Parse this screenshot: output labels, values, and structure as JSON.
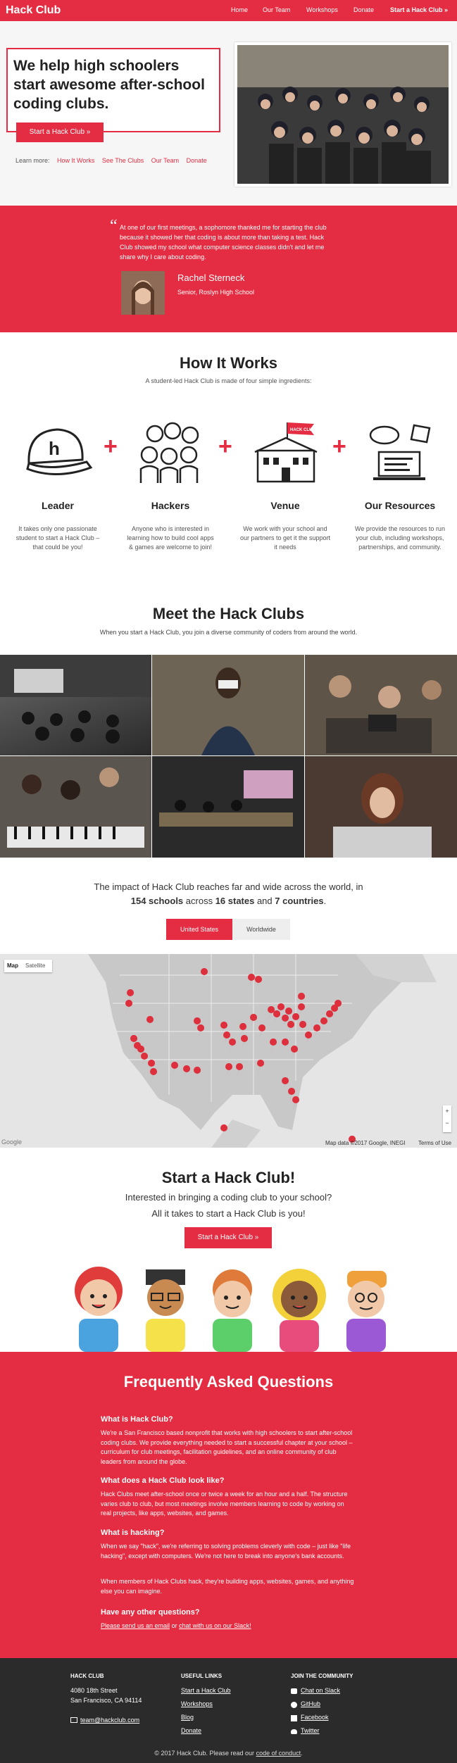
{
  "nav": {
    "logo": "Hack Club",
    "links": [
      "Home",
      "Our Team",
      "Workshops",
      "Donate"
    ],
    "cta": "Start a Hack Club »"
  },
  "hero": {
    "title": "We help high schoolers start awesome after-school coding clubs.",
    "button": "Start a Hack Club »",
    "learn_more_label": "Learn more:",
    "learn_links": [
      "How It Works",
      "See The Clubs",
      "Our Team",
      "Donate"
    ]
  },
  "testimonial": {
    "quote": "At one of our first meetings, a sophomore thanked me for starting the club because it showed her that coding is about more than taking a test. Hack Club showed my school what computer science classes didn't and let me share why I care about coding.",
    "name": "Rachel Sterneck",
    "role": "Senior, Roslyn High School"
  },
  "how": {
    "title": "How It Works",
    "subtitle": "A student-led Hack Club is made of four simple ingredients:",
    "banner_text": "HACK CLUB",
    "items": [
      {
        "title": "Leader",
        "desc": "It takes only one passionate student to start a Hack Club – that could be you!",
        "icon": "cap-icon"
      },
      {
        "title": "Hackers",
        "desc": "Anyone who is interested in learning how to build cool apps & games are welcome to join!",
        "icon": "people-icon"
      },
      {
        "title": "Venue",
        "desc": "We work with your school and our partners to get it the support it needs",
        "icon": "school-icon"
      },
      {
        "title": "Our Resources",
        "desc": "We provide the resources to run your club, including workshops, partnerships, and community.",
        "icon": "laptop-icon"
      }
    ]
  },
  "meet": {
    "title": "Meet the Hack Clubs",
    "subtitle": "When you start a Hack Club, you join a diverse community of coders from around the world."
  },
  "impact": {
    "line1": "The impact of Hack Club reaches far and wide across the world, in",
    "schools": "154 schools",
    "across": " across ",
    "states": "16 states",
    "and": " and ",
    "countries": "7 countries",
    "period": ".",
    "tab_us": "United States",
    "tab_world": "Worldwide"
  },
  "map": {
    "type_map": "Map",
    "type_satellite": "Satellite",
    "attribution": "Map data ©2017 Google, INEGI",
    "terms": "Terms of Use",
    "google": "Google",
    "zoom_in": "+",
    "zoom_out": "−"
  },
  "start": {
    "title": "Start a Hack Club!",
    "line1": "Interested in bringing a coding club to your school?",
    "line2": "All it takes to start a Hack Club is you!",
    "button": "Start a Hack Club »"
  },
  "faq": {
    "title": "Frequently Asked Questions",
    "items": [
      {
        "q": "What is Hack Club?",
        "a": "We're a San Francisco based nonprofit that works with high schoolers to start after-school coding clubs. We provide everything needed to start a successful chapter at your school – curriculum for club meetings, facilitation guidelines, and an online community of club leaders from around the globe."
      },
      {
        "q": "What does a Hack Club look like?",
        "a": "Hack Clubs meet after-school once or twice a week for an hour and a half. The structure varies club to club, but most meetings involve members learning to code by working on real projects, like apps, websites, and games."
      },
      {
        "q": "What is hacking?",
        "a": "When we say \"hack\", we're referring to solving problems cleverly with code – just like \"life hacking\", except with computers. We're not here to break into anyone's bank accounts.",
        "a2": "When members of Hack Clubs hack, they're building apps, websites, games, and anything else you can imagine."
      },
      {
        "q": "Have any other questions?",
        "link1": "Please send us an email",
        "or": " or ",
        "link2": "chat with us on our Slack!"
      }
    ]
  },
  "footer": {
    "col1_title": "HACK CLUB",
    "address1": "4080 18th Street",
    "address2": "San Francisco, CA 94114",
    "email": "team@hackclub.com",
    "col2_title": "USEFUL LINKS",
    "links": [
      "Start a Hack Club",
      "Workshops",
      "Blog",
      "Donate"
    ],
    "col3_title": "JOIN THE COMMUNITY",
    "community": [
      "Chat on Slack",
      "GitHub",
      "Facebook",
      "Twitter"
    ],
    "copyright": "© 2017 Hack Club. Please read our",
    "coc": "code of conduct",
    "period": "."
  },
  "colors": {
    "accent": "#e42d42",
    "dark": "#2b2b2b"
  }
}
